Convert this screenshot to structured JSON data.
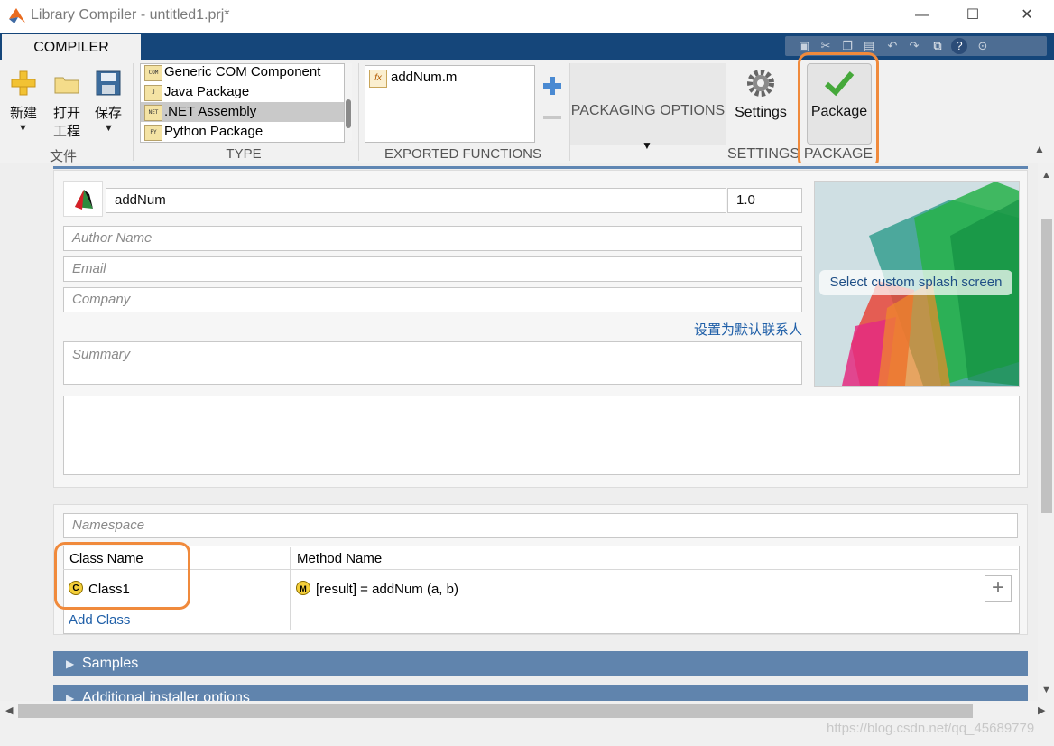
{
  "window": {
    "title": "Library Compiler - untitled1.prj*",
    "minimize": "—",
    "maximize": "☐",
    "close": "✕"
  },
  "ribbon": {
    "tab": "COMPILER",
    "file": {
      "new": "新建",
      "open_1": "打开",
      "open_2": "工程",
      "save": "保存",
      "section": "文件"
    },
    "type": {
      "items": [
        {
          "label": "Generic COM Component",
          "icon": "COM"
        },
        {
          "label": "Java Package",
          "icon": "J"
        },
        {
          "label": ".NET Assembly",
          "icon": "NET",
          "selected": true
        },
        {
          "label": "Python Package",
          "icon": "PY"
        }
      ],
      "section": "TYPE"
    },
    "exported": {
      "file": "addNum.m",
      "section": "EXPORTED FUNCTIONS"
    },
    "packaging": {
      "label": "PACKAGING OPTIONS"
    },
    "settings": {
      "label": "Settings",
      "section": "SETTINGS"
    },
    "package": {
      "label": "Package",
      "section": "PACKAGE"
    }
  },
  "form": {
    "app_name": "addNum",
    "version": "1.0",
    "author_placeholder": "Author Name",
    "email_placeholder": "Email",
    "company_placeholder": "Company",
    "default_contact_link": "设置为默认联系人",
    "summary_placeholder": "Summary",
    "splash_label": "Select custom splash screen"
  },
  "classes": {
    "namespace_placeholder": "Namespace",
    "col_class": "Class Name",
    "col_method": "Method Name",
    "class_name": "Class1",
    "method_sig": "[result] = addNum (a, b)",
    "add_class": "Add Class",
    "add_button": "+"
  },
  "sections": {
    "samples": "Samples",
    "additional": "Additional installer options"
  },
  "watermark": "https://blog.csdn.net/qq_45689779",
  "colors": {
    "ribbon_tab_bar": "#15467a",
    "accordion": "#6084ad",
    "highlight": "#f08a3c",
    "link": "#1f5fa8"
  }
}
